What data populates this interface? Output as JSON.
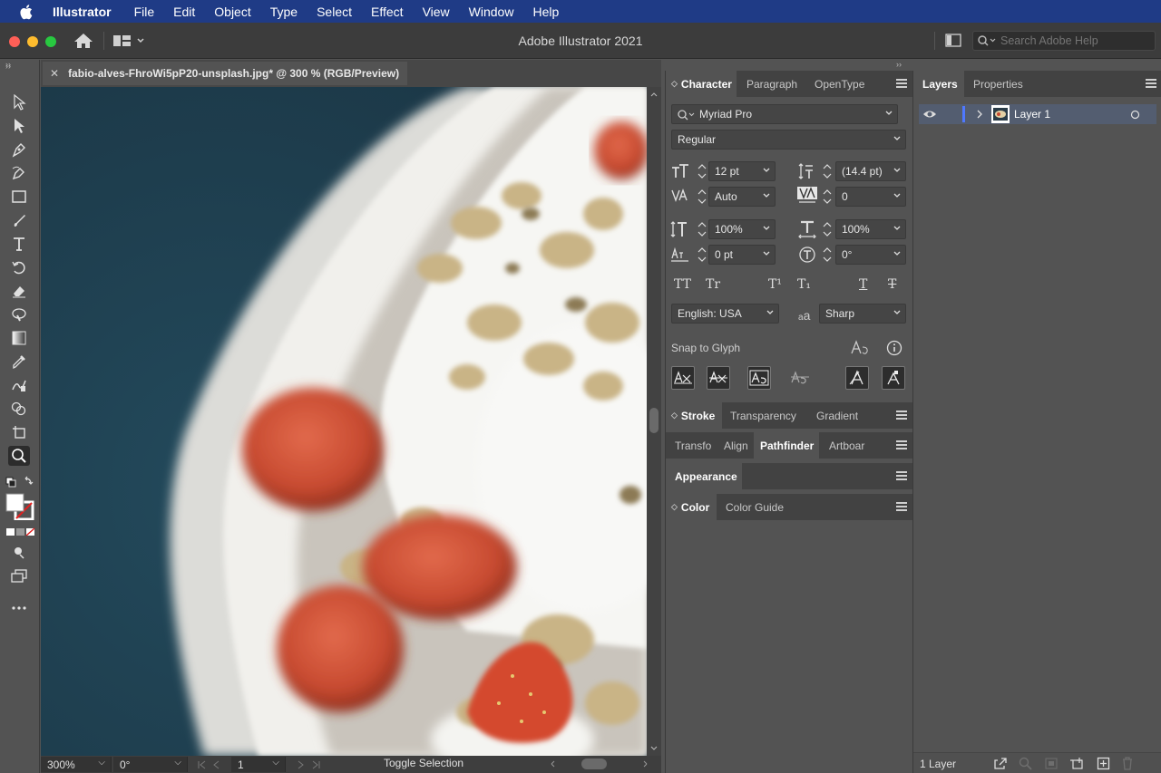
{
  "menubar": {
    "app_name": "Illustrator",
    "items": [
      "File",
      "Edit",
      "Object",
      "Type",
      "Select",
      "Effect",
      "View",
      "Window",
      "Help"
    ]
  },
  "titlebar": {
    "title": "Adobe Illustrator 2021",
    "search_placeholder": "Search Adobe Help"
  },
  "document": {
    "tab_name": "fabio-alves-FhroWi5pP20-unsplash.jpg* @ 300 % (RGB/Preview)"
  },
  "statusbar": {
    "zoom": "300%",
    "rotation": "0°",
    "artboard": "1",
    "status_text": "Toggle Selection"
  },
  "character_panel": {
    "tabs": [
      "Character",
      "Paragraph",
      "OpenType"
    ],
    "font_family": "Myriad Pro",
    "font_style": "Regular",
    "font_size": "12 pt",
    "leading": "(14.4 pt)",
    "kerning": "Auto",
    "tracking": "0",
    "vertical_scale": "100%",
    "horizontal_scale": "100%",
    "baseline_shift": "0 pt",
    "rotation": "0°",
    "language": "English: USA",
    "antialias_label": "a",
    "antialias": "Sharp",
    "snap_label": "Snap to Glyph",
    "case_buttons": [
      "TT",
      "Tr",
      "T¹",
      "T₁",
      "T",
      "T"
    ]
  },
  "stroke_group": {
    "tabs": [
      "Stroke",
      "Transparency",
      "Gradient"
    ]
  },
  "transform_group": {
    "tabs": [
      "Transfo",
      "Align",
      "Pathfinder",
      "Artboar"
    ]
  },
  "appearance_group": {
    "tabs": [
      "Appearance"
    ]
  },
  "color_group": {
    "tabs": [
      "Color",
      "Color Guide"
    ]
  },
  "layers_panel": {
    "tabs": [
      "Layers",
      "Properties"
    ],
    "layer_name": "Layer 1",
    "footer_count": "1 Layer"
  },
  "colors": {
    "menubar_bg": "#1f3b86",
    "panel_bg": "#535353",
    "selected_layer": "#535d70",
    "layer_color_bar": "#4f78ff"
  }
}
